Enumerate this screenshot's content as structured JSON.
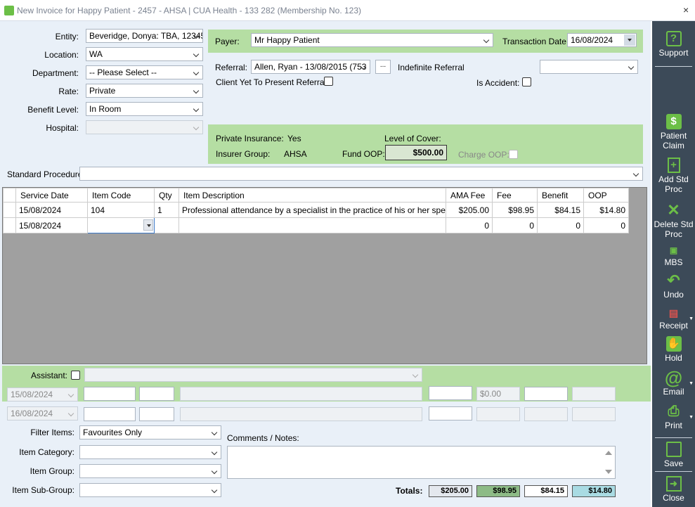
{
  "window": {
    "title": "New Invoice for Happy Patient - 2457 - AHSA | CUA Health - 133 282 (Membership No. 123)",
    "close": "×"
  },
  "left_form": {
    "entity": {
      "label": "Entity:",
      "value": "Beveridge, Donya: TBA, 12345"
    },
    "location": {
      "label": "Location:",
      "value": "WA"
    },
    "department": {
      "label": "Department:",
      "value": "-- Please Select --"
    },
    "rate": {
      "label": "Rate:",
      "value": "Private"
    },
    "benefit_level": {
      "label": "Benefit Level:",
      "value": "In Room"
    },
    "hospital": {
      "label": "Hospital:",
      "value": ""
    }
  },
  "payer": {
    "label": "Payer:",
    "value": "Mr Happy Patient",
    "transaction_date_label": "Transaction Date",
    "transaction_date": "16/08/2024"
  },
  "referral": {
    "label": "Referral:",
    "value": "Allen, Ryan - 13/08/2015 (753",
    "ellipsis": "...",
    "indefinite_label": "Indefinite Referral",
    "client_yet_label": "Client Yet To Present Referral:",
    "is_accident_label": "Is Accident:",
    "right_select": ""
  },
  "insurance": {
    "private_insurance_label": "Private Insurance:",
    "private_insurance_value": "Yes",
    "level_of_cover_label": "Level of Cover:",
    "insurer_group_label": "Insurer Group:",
    "insurer_group_value": "AHSA",
    "fund_oop_label": "Fund OOP:",
    "fund_oop_value": "$500.00",
    "charge_oop_label": "Charge OOP:"
  },
  "standard_procedure": {
    "label": "Standard Procedure:",
    "value": ""
  },
  "grid": {
    "headers": [
      "Service Date",
      "Item Code",
      "Qty",
      "Item Description",
      "AMA Fee",
      "Fee",
      "Benefit",
      "OOP"
    ],
    "rows": [
      [
        "15/08/2024",
        "104",
        "1",
        "Professional attendance by a specialist in the practice of his or her spe...",
        "$205.00",
        "$98.95",
        "$84.15",
        "$14.80"
      ],
      [
        "15/08/2024",
        "",
        "",
        "",
        "0",
        "0",
        "0",
        "0"
      ]
    ]
  },
  "assistant": {
    "label": "Assistant:",
    "row1_date": "15/08/2024",
    "row1_amount": "$0.00",
    "row2_date": "16/08/2024"
  },
  "filters": {
    "filter_items": {
      "label": "Filter Items:",
      "value": "Favourites Only"
    },
    "item_category": {
      "label": "Item Category:",
      "value": ""
    },
    "item_group": {
      "label": "Item Group:",
      "value": ""
    },
    "item_subgroup": {
      "label": "Item Sub-Group:",
      "value": ""
    },
    "comments_label": "Comments / Notes:"
  },
  "totals": {
    "label": "Totals:",
    "ama_fee": "$205.00",
    "fee": "$98.95",
    "benefit": "$84.15",
    "oop": "$14.80"
  },
  "sidebar": {
    "support": "Support",
    "patient_claim": "Patient Claim",
    "add_std_proc": "Add Std Proc",
    "delete_std_proc": "Delete Std Proc",
    "mbs": "MBS",
    "undo": "Undo",
    "receipt": "Receipt",
    "hold": "Hold",
    "email": "Email",
    "print": "Print",
    "save": "Save",
    "close": "Close"
  },
  "colors": {
    "accent_green": "#6cbf47",
    "panel_green": "#b5dea3",
    "sidebar_bg": "#3c4a58",
    "fee_total_bg": "#8dbb86",
    "oop_total_bg": "#a9dbe3"
  }
}
